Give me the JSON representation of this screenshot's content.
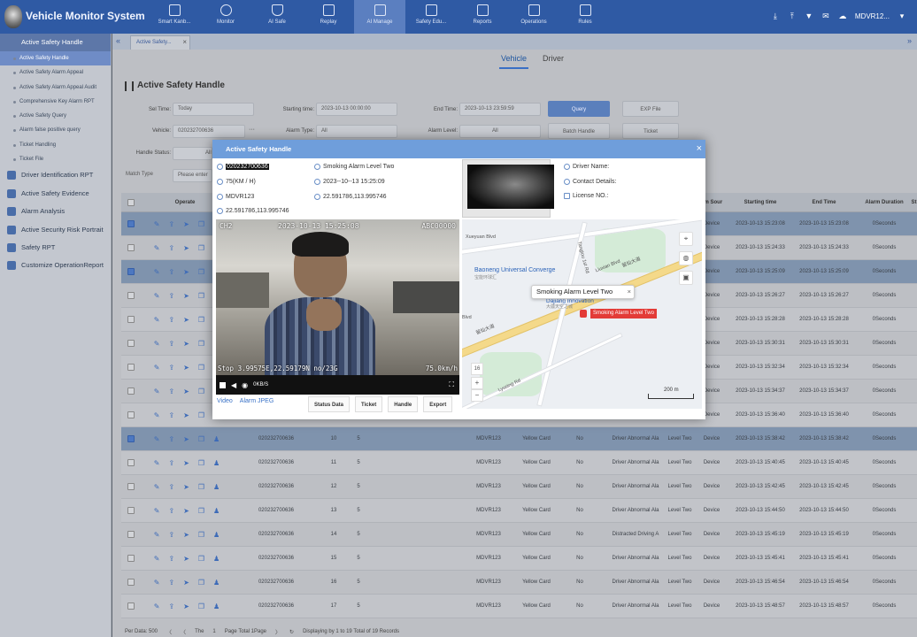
{
  "app": {
    "title": "Vehicle Monitor System"
  },
  "nav": [
    {
      "label": "Smart Kanb...",
      "icon": "dashboard-icon"
    },
    {
      "label": "Monitor",
      "icon": "monitor-icon"
    },
    {
      "label": "AI Safe",
      "icon": "shield-icon"
    },
    {
      "label": "Replay",
      "icon": "replay-icon"
    },
    {
      "label": "AI Manage",
      "icon": "ai-manage-icon"
    },
    {
      "label": "Safety Edu...",
      "icon": "education-icon"
    },
    {
      "label": "Reports",
      "icon": "reports-icon"
    },
    {
      "label": "Operations",
      "icon": "operations-icon"
    },
    {
      "label": "Rules",
      "icon": "rules-icon"
    }
  ],
  "topright": {
    "user": "MDVR12...",
    "icons": [
      "download-icon",
      "upload-icon",
      "shirt-icon",
      "mail-icon",
      "cloud-icon"
    ]
  },
  "sidebar": {
    "header": "Active Safety Handle",
    "items": [
      "Active Safety Handle",
      "Active Safety Alarm Appeal",
      "Active Safety Alarm Appeal Audit",
      "Comprehensive Key Alarm RPT",
      "Active Safety Query",
      "Alarm false positive query",
      "Ticket Handling",
      "Ticket File"
    ],
    "sections": [
      "Driver Identification RPT",
      "Active Safety Evidence",
      "Alarm Analysis",
      "Active Security Risk Portrait",
      "Safety RPT",
      "Customize OperationReport"
    ]
  },
  "tabs": {
    "open_tab": "Active Safety...",
    "close": "×",
    "collapse": "«",
    "expand": "»"
  },
  "subtabs": [
    "Vehicle",
    "Driver"
  ],
  "page": {
    "heading": "Active Safety Handle"
  },
  "filters": {
    "sel_time_label": "Sel Time:",
    "sel_time_value": "Today",
    "start_label": "Starting time:",
    "start_value": "2023-10-13 00:00:00",
    "end_label": "End Time:",
    "end_value": "2023-10-13 23:59:59",
    "query": "Query",
    "exp_file": "EXP File",
    "vehicle_label": "Vehicle:",
    "vehicle_value": "020232700636",
    "vehicle_more": "···",
    "alarm_type_label": "Alarm Type:",
    "alarm_type_value": "All",
    "alarm_level_label": "Alarm Level:",
    "alarm_level_value": "All",
    "batch_handle": "Batch Handle",
    "ticket": "Ticket",
    "handle_status_label": "Handle Status:",
    "handle_status_value": "All",
    "match_type": "Match Type",
    "enter_placeholder": "Please enter"
  },
  "table": {
    "headers": [
      "Operate",
      "Alarm Sour",
      "Starting time",
      "End Time",
      "Alarm Duration",
      "St"
    ],
    "rows": [
      {
        "start": "2023-10-13 15:23:08",
        "end": "2023-10-13 15:23:08",
        "dur": "0Seconds",
        "src": "Device",
        "sel": true
      },
      {
        "start": "2023-10-13 15:24:33",
        "end": "2023-10-13 15:24:33",
        "dur": "0Seconds",
        "src": "Device",
        "sel": false
      },
      {
        "start": "2023-10-13 15:25:09",
        "end": "2023-10-13 15:25:09",
        "dur": "0Seconds",
        "src": "Device",
        "sel": true
      },
      {
        "start": "2023-10-13 15:26:27",
        "end": "2023-10-13 15:26:27",
        "dur": "0Seconds",
        "src": "Device",
        "sel": false
      },
      {
        "start": "2023-10-13 15:28:28",
        "end": "2023-10-13 15:28:28",
        "dur": "0Seconds",
        "src": "Device",
        "sel": false
      },
      {
        "start": "2023-10-13 15:30:31",
        "end": "2023-10-13 15:30:31",
        "dur": "0Seconds",
        "src": "Device",
        "sel": false
      },
      {
        "start": "2023-10-13 15:32:34",
        "end": "2023-10-13 15:32:34",
        "dur": "0Seconds",
        "src": "Device",
        "sel": false
      },
      {
        "start": "2023-10-13 15:34:37",
        "end": "2023-10-13 15:34:37",
        "dur": "0Seconds",
        "src": "Device",
        "sel": false
      },
      {
        "start": "2023-10-13 15:36:40",
        "end": "2023-10-13 15:36:40",
        "dur": "0Seconds",
        "src": "Device",
        "sel": false
      },
      {
        "vehicle": "020232700636",
        "no": "10",
        "n": "5",
        "dev": "MDVR123",
        "card": "Yellow Card",
        "yn": "No",
        "type": "Driver Abnormal Ala",
        "level": "Level Two",
        "src": "Device",
        "start": "2023-10-13 15:38:42",
        "end": "2023-10-13 15:38:42",
        "dur": "0Seconds",
        "sel": true
      },
      {
        "vehicle": "020232700636",
        "no": "11",
        "n": "5",
        "dev": "MDVR123",
        "card": "Yellow Card",
        "yn": "No",
        "type": "Driver Abnormal Ala",
        "level": "Level Two",
        "src": "Device",
        "start": "2023-10-13 15:40:45",
        "end": "2023-10-13 15:40:45",
        "dur": "0Seconds",
        "sel": false
      },
      {
        "vehicle": "020232700636",
        "no": "12",
        "n": "5",
        "dev": "MDVR123",
        "card": "Yellow Card",
        "yn": "No",
        "type": "Driver Abnormal Ala",
        "level": "Level Two",
        "src": "Device",
        "start": "2023-10-13 15:42:45",
        "end": "2023-10-13 15:42:45",
        "dur": "0Seconds",
        "sel": false
      },
      {
        "vehicle": "020232700636",
        "no": "13",
        "n": "5",
        "dev": "MDVR123",
        "card": "Yellow Card",
        "yn": "No",
        "type": "Driver Abnormal Ala",
        "level": "Level Two",
        "src": "Device",
        "start": "2023-10-13 15:44:50",
        "end": "2023-10-13 15:44:50",
        "dur": "0Seconds",
        "sel": false
      },
      {
        "vehicle": "020232700636",
        "no": "14",
        "n": "5",
        "dev": "MDVR123",
        "card": "Yellow Card",
        "yn": "No",
        "type": "Distracted Driving A",
        "level": "Level Two",
        "src": "Device",
        "start": "2023-10-13 15:45:19",
        "end": "2023-10-13 15:45:19",
        "dur": "0Seconds",
        "sel": false
      },
      {
        "vehicle": "020232700636",
        "no": "15",
        "n": "5",
        "dev": "MDVR123",
        "card": "Yellow Card",
        "yn": "No",
        "type": "Driver Abnormal Ala",
        "level": "Level Two",
        "src": "Device",
        "start": "2023-10-13 15:45:41",
        "end": "2023-10-13 15:45:41",
        "dur": "0Seconds",
        "sel": false
      },
      {
        "vehicle": "020232700636",
        "no": "16",
        "n": "5",
        "dev": "MDVR123",
        "card": "Yellow Card",
        "yn": "No",
        "type": "Driver Abnormal Ala",
        "level": "Level Two",
        "src": "Device",
        "start": "2023-10-13 15:46:54",
        "end": "2023-10-13 15:46:54",
        "dur": "0Seconds",
        "sel": false
      },
      {
        "vehicle": "020232700636",
        "no": "17",
        "n": "5",
        "dev": "MDVR123",
        "card": "Yellow Card",
        "yn": "No",
        "type": "Driver Abnormal Ala",
        "level": "Level Two",
        "src": "Device",
        "start": "2023-10-13 15:48:57",
        "end": "2023-10-13 15:48:57",
        "dur": "0Seconds",
        "sel": false
      }
    ]
  },
  "pager": {
    "per_data": "Per Data: 500",
    "the": "The",
    "page_no": "1",
    "page_total": "Page  Total 1Page",
    "displaying": "Displaying by 1 to 19 Total of 19 Records"
  },
  "modal": {
    "title": "Active Safety Handle",
    "close": "×",
    "plate": "020232700636",
    "speed": "75(KM / H)",
    "device": "MDVR123",
    "location_top": "22.591786,113.995746",
    "alarm_type": "Smoking Alarm Level Two",
    "time": "2023--10--13 15:25:09",
    "location": "22.591786,113.995746",
    "driver_name_label": "Driver Name:",
    "contact_label": "Contact Details:",
    "license_label": "License NO.:",
    "video": {
      "channel": "CH2",
      "timestamp": "2023-10-13 15:25:08",
      "device_code": "ABC00000",
      "stop_line": "Stop 3.99575E,22.59179N no/23G",
      "speed_osd": "75.0km/h",
      "rate": "0KB/S"
    },
    "video_tabs": [
      "Video",
      "Alarm JPEG"
    ],
    "buttons": [
      "Status Data",
      "Ticket",
      "Handle",
      "Export"
    ],
    "map": {
      "callout": "Smoking Alarm Level Two",
      "callout_close": "×",
      "alarm_tag": "Smoking Alarm Level Two",
      "poi1": "Baoneng Universal Converge",
      "poi1_sub": "宝能环球汇",
      "poi2": "Dajiang Innovation",
      "poi2_sub": "大疆天空之城",
      "road1": "Xueyuan Blvd",
      "road2": "留仙大道",
      "road3": "Liuxian Blvd",
      "road4": "Tangtou 1st Rd",
      "road5": "Lyusing Rd",
      "road6": "Blvd",
      "road7": "留仙大道",
      "zoom_level": "16",
      "zoom_in": "+",
      "zoom_out": "−",
      "scale": "200 m"
    }
  }
}
